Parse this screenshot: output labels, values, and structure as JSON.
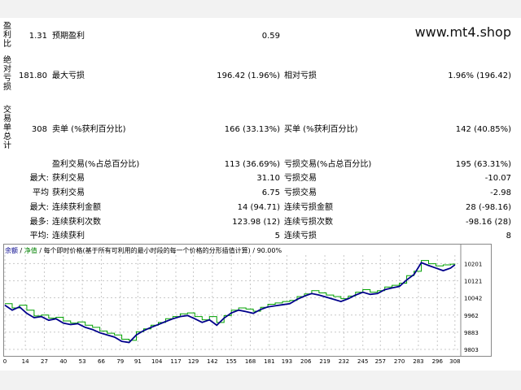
{
  "watermark": "www.mt4.shop",
  "sections": [
    {
      "label": "盈利比",
      "rows": [
        {
          "v0": "1.31",
          "k1": "预期盈利",
          "v1": "0.59",
          "k2": "",
          "v2": ""
        }
      ]
    },
    {
      "label": "绝对亏损",
      "rows": [
        {
          "v0": "181.80",
          "k1": "最大亏损",
          "v1": "196.42 (1.96%)",
          "k2": "相对亏损",
          "v2": "1.96% (196.42)"
        }
      ]
    },
    {
      "label": "交易单总计",
      "rows": [
        {
          "v0": "308",
          "k1": "卖单 (%获利百分比)",
          "v1": "166 (33.13%)",
          "k2": "买单 (%获利百分比)",
          "v2": "142 (40.85%)"
        }
      ]
    }
  ],
  "stats": [
    {
      "prefix": "",
      "k1": "盈利交易(%占总百分比)",
      "v1": "113 (36.69%)",
      "k2": "亏损交易(%占总百分比)",
      "v2": "195 (63.31%)"
    },
    {
      "prefix": "最大:",
      "k1": "获利交易",
      "v1": "31.10",
      "k2": "亏损交易",
      "v2": "-10.07"
    },
    {
      "prefix": "平均",
      "k1": "获利交易",
      "v1": "6.75",
      "k2": "亏损交易",
      "v2": "-2.98"
    },
    {
      "prefix": "最大:",
      "k1": "连续获利金额",
      "v1": "14 (94.71)",
      "k2": "连续亏损金额",
      "v2": "28 (-98.16)"
    },
    {
      "prefix": "最多:",
      "k1": "连续获利次数",
      "v1": "123.98 (12)",
      "k2": "连续亏损次数",
      "v2": "-98.16 (28)"
    },
    {
      "prefix": "平均:",
      "k1": "连续获利",
      "v1": "5",
      "k2": "连续亏损",
      "v2": "8"
    }
  ],
  "legend": {
    "account": "余额",
    "sep1": " / ",
    "net": "净值",
    "sep2": " / ",
    "desc": "每个即时价格(基于所有可利用的最小时段的每一个价格的分形插值计算) / 90.00%"
  },
  "chart_data": {
    "type": "line",
    "x_ticks": [
      0,
      14,
      27,
      40,
      53,
      66,
      79,
      91,
      104,
      117,
      129,
      142,
      155,
      168,
      181,
      193,
      206,
      219,
      232,
      245,
      257,
      270,
      283,
      296,
      308
    ],
    "y_ticks": [
      10201,
      10121,
      10042,
      9962,
      9883,
      9803
    ],
    "xlim": [
      0,
      312
    ],
    "ylim": [
      9803,
      10240
    ],
    "series": [
      {
        "role": "balance",
        "color": "#00008b",
        "x": [
          0,
          5,
          10,
          15,
          20,
          25,
          30,
          35,
          40,
          45,
          50,
          55,
          60,
          65,
          70,
          75,
          80,
          85,
          90,
          95,
          100,
          105,
          110,
          115,
          120,
          125,
          130,
          135,
          140,
          145,
          150,
          155,
          160,
          165,
          170,
          175,
          180,
          185,
          190,
          195,
          200,
          205,
          210,
          215,
          220,
          225,
          230,
          235,
          240,
          245,
          250,
          255,
          260,
          265,
          270,
          275,
          280,
          285,
          290,
          295,
          300,
          305,
          308
        ],
        "values": [
          10008,
          9985,
          10000,
          9970,
          9950,
          9955,
          9938,
          9945,
          9925,
          9918,
          9922,
          9905,
          9895,
          9880,
          9870,
          9860,
          9840,
          9835,
          9870,
          9890,
          9905,
          9918,
          9932,
          9945,
          9955,
          9960,
          9945,
          9928,
          9940,
          9915,
          9948,
          9972,
          9985,
          9978,
          9970,
          9988,
          10000,
          10005,
          10010,
          10015,
          10035,
          10050,
          10062,
          10055,
          10045,
          10035,
          10025,
          10038,
          10055,
          10068,
          10058,
          10062,
          10080,
          10088,
          10095,
          10125,
          10150,
          10205,
          10192,
          10180,
          10168,
          10180,
          10195
        ]
      },
      {
        "role": "equity",
        "color": "#00a000",
        "x": [
          0,
          5,
          10,
          15,
          20,
          25,
          30,
          35,
          40,
          45,
          50,
          55,
          60,
          65,
          70,
          75,
          80,
          85,
          90,
          95,
          100,
          105,
          110,
          115,
          120,
          125,
          130,
          135,
          140,
          145,
          150,
          155,
          160,
          165,
          170,
          175,
          180,
          185,
          190,
          195,
          200,
          205,
          210,
          215,
          220,
          225,
          230,
          235,
          240,
          245,
          250,
          255,
          260,
          265,
          270,
          275,
          280,
          285,
          290,
          295,
          300,
          305,
          308
        ],
        "values": [
          10015,
          9995,
          10008,
          9985,
          9958,
          9962,
          9948,
          9952,
          9935,
          9925,
          9930,
          9915,
          9905,
          9888,
          9878,
          9870,
          9850,
          9845,
          9885,
          9898,
          9915,
          9928,
          9945,
          9955,
          9968,
          9972,
          9955,
          9940,
          9955,
          9928,
          9960,
          9985,
          9995,
          9990,
          9980,
          9998,
          10012,
          10018,
          10025,
          10030,
          10048,
          10060,
          10075,
          10065,
          10055,
          10048,
          10038,
          10050,
          10068,
          10080,
          10068,
          10075,
          10092,
          10100,
          10110,
          10145,
          10165,
          10215,
          10200,
          10190,
          10195,
          10198,
          10200
        ]
      }
    ]
  }
}
